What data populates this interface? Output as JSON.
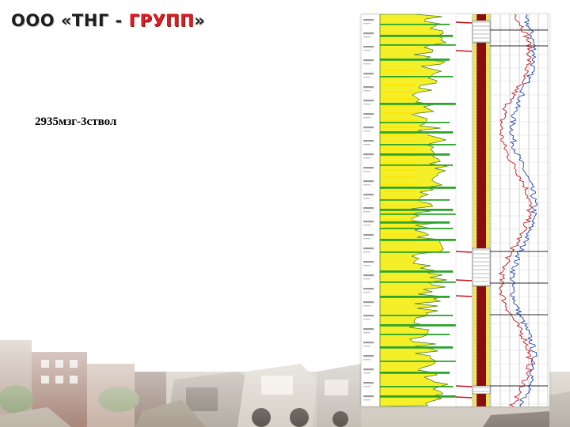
{
  "slide": {
    "logo": {
      "company_prefix": "ООО «ТНГ - ",
      "company_highlight": "ГРУПП",
      "company_suffix": "»"
    },
    "caption": "2935мзг-3ствол"
  },
  "well_log": {
    "depth_scale": "illegible",
    "side_note": "illegible",
    "colors": {
      "lithology_fill": "#f5ef2a",
      "lithology_bright": "#ffe600",
      "reservoir_band": "#2da52d",
      "casing": "#8b0d12",
      "curve_red": "#c8141c",
      "curve_blue": "#1b3fae",
      "grid": "#9a9a9a"
    }
  }
}
